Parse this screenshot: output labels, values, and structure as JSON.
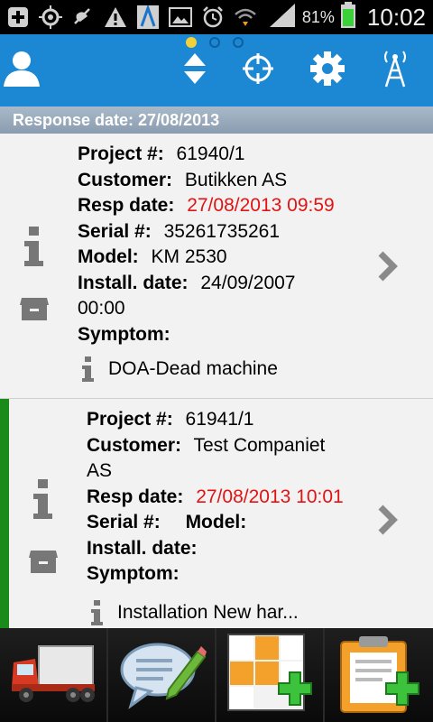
{
  "status_bar": {
    "battery_percent": "81%",
    "time": "10:02",
    "icons": [
      "add-icon",
      "gps-icon",
      "satellite-off-icon",
      "warning-icon",
      "app-a-icon",
      "image-icon",
      "alarm-icon",
      "wifi-download-icon",
      "signal-icon",
      "battery-icon"
    ]
  },
  "action_bar": {
    "page_indicator": {
      "count": 3,
      "active": 1
    },
    "icons": [
      "user-icon",
      "sort-updown-icon",
      "target-icon",
      "gear-icon",
      "antenna-icon"
    ]
  },
  "section_header": "Response date: 27/08/2013",
  "items": [
    {
      "project_label": "Project #:",
      "project": "61940/1",
      "customer_label": "Customer:",
      "customer": "Butikken AS",
      "resp_label": "Resp date:",
      "resp": "27/08/2013 09:59",
      "serial_label": "Serial #:",
      "serial": "35261735261",
      "model_label": "Model:",
      "model": "KM 2530",
      "install_label": "Install. date:",
      "install": "24/09/2007",
      "install_time": "00:00",
      "symptom_label": "Symptom:",
      "note": "DOA-Dead machine",
      "highlight": false
    },
    {
      "project_label": "Project #:",
      "project": "61941/1",
      "customer_label": "Customer:",
      "customer": "Test Companiet",
      "customer_cont": "AS",
      "resp_label": "Resp date:",
      "resp": "27/08/2013 10:01",
      "serial_label": "Serial #:",
      "model_label": "Model:",
      "install_label": "Install. date:",
      "symptom_label": "Symptom:",
      "note": "Installation New har...",
      "highlight": true,
      "highlight_color": "#1a8a1a"
    }
  ],
  "bottom_bar": [
    "truck-icon",
    "comment-edit-icon",
    "grid-add-icon",
    "clipboard-add-icon"
  ],
  "colors": {
    "action_bar": "#1c88d4",
    "resp_date_red": "#e21313",
    "list_bg": "#f2f2f2",
    "page_dot_active": "#f3d13a"
  }
}
